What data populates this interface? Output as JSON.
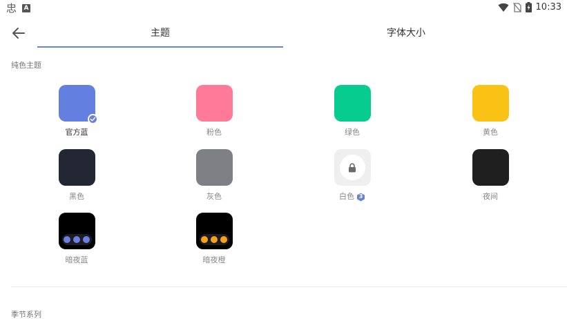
{
  "status_bar": {
    "app_glyph": "忠",
    "a_icon_text": "A",
    "time": "10:33"
  },
  "tabs": [
    {
      "label": "主题",
      "active": true
    },
    {
      "label": "字体大小",
      "active": false
    }
  ],
  "accent_color": "#6a82d6",
  "sections": {
    "solid_title": "纯色主题",
    "season_title": "季节系列"
  },
  "themes": [
    {
      "label": "官方蓝",
      "color": "#6380e0",
      "selected": true
    },
    {
      "label": "粉色",
      "color": "#ff7a99"
    },
    {
      "label": "绿色",
      "color": "#06cd8f"
    },
    {
      "label": "黄色",
      "color": "#f9c214"
    },
    {
      "label": "黑色",
      "color": "#232733"
    },
    {
      "label": "灰色",
      "color": "#7f8086"
    },
    {
      "label": "白色",
      "color": "#efefef",
      "locked": true,
      "level": "3"
    },
    {
      "label": "夜间",
      "color": "#1f1f1f"
    },
    {
      "label": "暗夜蓝",
      "color": "#000000",
      "dot_color": "#6a7fe0"
    },
    {
      "label": "暗夜橙",
      "color": "#000000",
      "dot_color": "#f5a11e"
    }
  ]
}
